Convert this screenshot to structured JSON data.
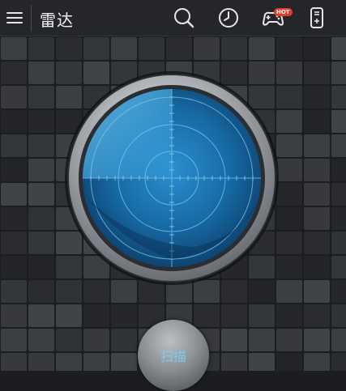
{
  "header": {
    "title": "雷达",
    "hot_badge": "HOT"
  },
  "icons": {
    "menu": "menu-icon",
    "search": "search-icon",
    "history": "clock-icon",
    "game": "gamepad-icon",
    "remote": "remote-control-icon"
  },
  "scan_button": {
    "label": "扫描"
  },
  "colors": {
    "topbar": "#24262a",
    "background": "#1b1d20",
    "radar_blue": "#1f6fa8",
    "scan_label": "#7fc8f0"
  }
}
